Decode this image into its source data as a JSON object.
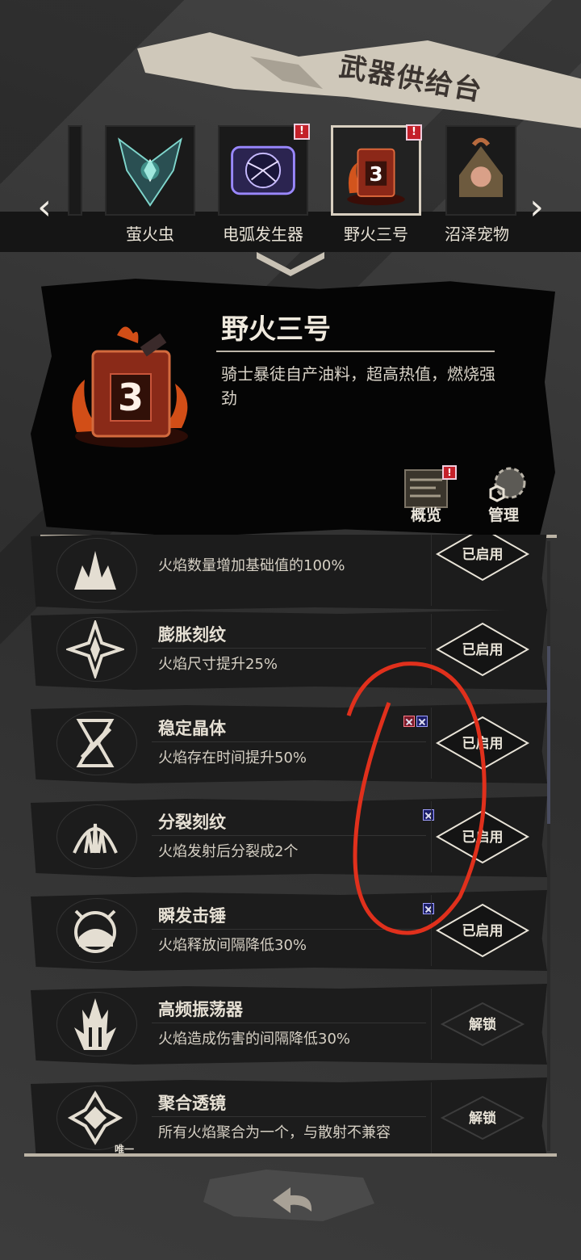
{
  "header": {
    "title": "武器供给台"
  },
  "tabs": [
    {
      "label": "",
      "badge": false,
      "icon": "partial-weapon-icon"
    },
    {
      "label": "萤火虫",
      "badge": false,
      "icon": "firefly-icon"
    },
    {
      "label": "电弧发生器",
      "badge": true,
      "icon": "arc-generator-icon"
    },
    {
      "label": "野火三号",
      "badge": true,
      "icon": "wildfire-fuel-can-icon",
      "active": true
    },
    {
      "label": "沼泽宠物",
      "badge": false,
      "icon": "swamp-pet-icon"
    }
  ],
  "detail": {
    "name": "野火三号",
    "desc": "骑士暴徒自产油料，超高热值，燃烧强劲",
    "buttons": [
      {
        "label": "概览",
        "badge": true
      },
      {
        "label": "管理",
        "badge": false
      }
    ]
  },
  "upgrades": [
    {
      "name": "",
      "desc": "火焰数量增加基础值的100%",
      "status": "已启用",
      "icon": "multiply-flame-icon"
    },
    {
      "name": "膨胀刻纹",
      "desc": "火焰尺寸提升25%",
      "status": "已启用",
      "icon": "expand-rune-icon"
    },
    {
      "name": "稳定晶体",
      "desc": "火焰存在时间提升50%",
      "status": "已启用",
      "icon": "hourglass-crystal-icon",
      "tags": [
        "red",
        "blue"
      ]
    },
    {
      "name": "分裂刻纹",
      "desc": "火焰发射后分裂成2个",
      "status": "已启用",
      "icon": "split-rune-icon",
      "tags": [
        "blue"
      ]
    },
    {
      "name": "瞬发击锤",
      "desc": "火焰释放间隔降低30%",
      "status": "已启用",
      "icon": "hammer-gauge-icon",
      "tags": [
        "blue"
      ]
    },
    {
      "name": "高频振荡器",
      "desc": "火焰造成伤害的间隔降低30%",
      "status": "解锁",
      "icon": "oscillator-icon"
    },
    {
      "name": "聚合透镜",
      "desc": "所有火焰聚合为一个，与散射不兼容",
      "status": "解锁",
      "icon": "converge-lens-icon",
      "note": "唯一"
    }
  ],
  "colors": {
    "badge_red": "#c4202a",
    "annotation": "#e0301c"
  }
}
